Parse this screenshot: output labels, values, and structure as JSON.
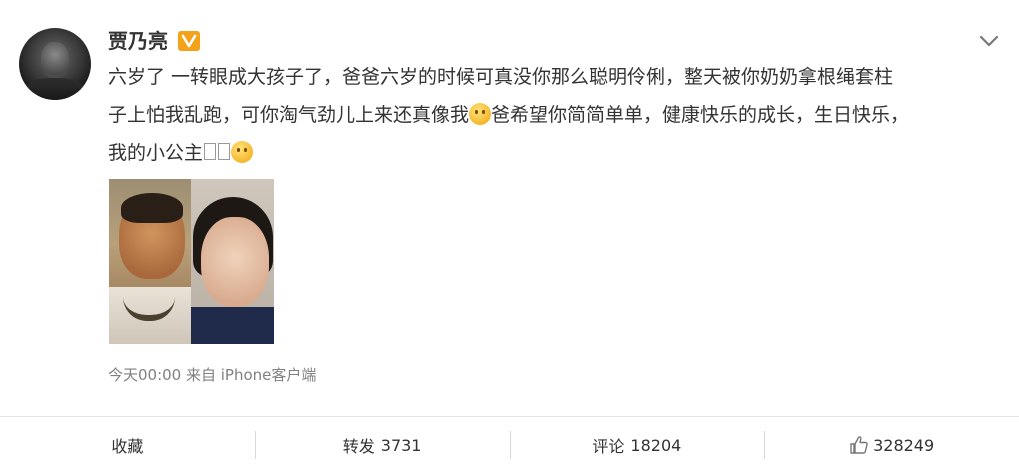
{
  "post": {
    "author": "贾乃亮",
    "verified_badge": "V",
    "text_line1_a": "六岁了 一转眼成大孩子了，爸爸六岁的时候可真没你那么聪明伶俐，整天被你奶奶拿根绳套柱",
    "text_line2_a": "子上怕我乱跑，可你淘气劲儿上来还真像我",
    "text_line2_b": "爸希望你简简单单，健康快乐的成长，生日快乐，",
    "text_line3_a": "我的小公主",
    "meta": "今天00:00 来自 iPhone客户端",
    "emoji_1": "smirk-emoji",
    "emoji_2": "kiss-emoji"
  },
  "actions": {
    "favorite_label": "收藏",
    "repost_label": "转发",
    "repost_count": "3731",
    "comment_label": "评论",
    "comment_count": "18204",
    "like_count": "328249"
  },
  "colors": {
    "badge": "#f5a21b",
    "text": "#333333",
    "meta": "#808080"
  }
}
